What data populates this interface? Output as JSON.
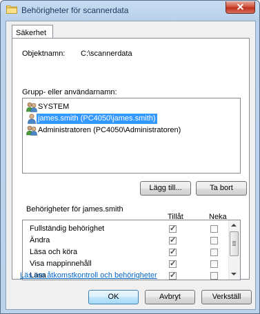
{
  "window": {
    "title": "Behörigheter för scannerdata",
    "close_glyph": "✕"
  },
  "tab": {
    "label": "Säkerhet"
  },
  "object": {
    "label": "Objektnamn:",
    "value": "C:\\scannerdata"
  },
  "users": {
    "label": "Grupp- eller användarnamn:",
    "items": [
      {
        "label": "SYSTEM",
        "icon": "users-group-icon",
        "selected": false
      },
      {
        "label": "james.smith (PC4050\\james.smith)",
        "icon": "user-icon",
        "selected": true
      },
      {
        "label": "Administratoren (PC4050\\Administratoren)",
        "icon": "users-group-icon",
        "selected": false
      }
    ],
    "add_label": "Lägg till...",
    "remove_label": "Ta bort"
  },
  "permissions": {
    "label": "Behörigheter för james.smith",
    "allow_header": "Tillåt",
    "deny_header": "Neka",
    "rows": [
      {
        "label": "Fullständig behörighet",
        "allow": true,
        "deny": false
      },
      {
        "label": "Ändra",
        "allow": true,
        "deny": false
      },
      {
        "label": "Läsa och köra",
        "allow": true,
        "deny": false
      },
      {
        "label": "Visa mappinnehåll",
        "allow": true,
        "deny": false
      },
      {
        "label": "Läsa",
        "allow": true,
        "deny": false
      }
    ]
  },
  "link_text": "Läs om åtkomstkontroll och behörigheter",
  "footer": {
    "ok_label": "OK",
    "cancel_label": "Avbryt",
    "apply_label": "Verkställ"
  },
  "colors": {
    "selection": "#3399ff",
    "link": "#0066cc",
    "close": "#c7412b"
  }
}
